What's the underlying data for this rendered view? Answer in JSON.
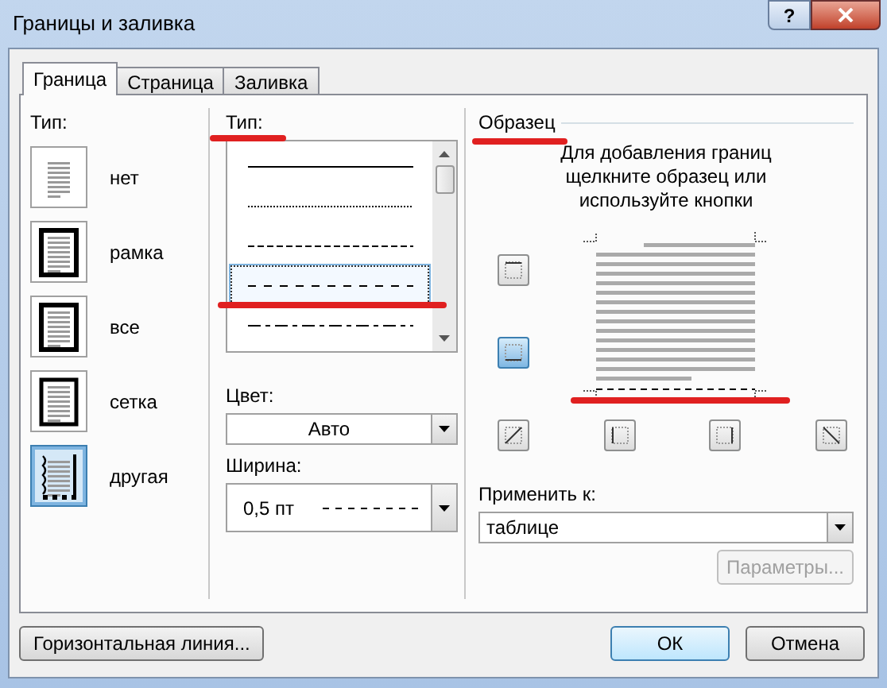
{
  "window": {
    "title": "Границы и заливка",
    "help": "?"
  },
  "tabs": [
    {
      "label": "Граница",
      "selected": true
    },
    {
      "label": "Страница",
      "selected": false
    },
    {
      "label": "Заливка",
      "selected": false
    }
  ],
  "setting": {
    "label": "Тип:",
    "items": [
      {
        "label": "нет",
        "kind": "none",
        "selected": false
      },
      {
        "label": "рамка",
        "kind": "box",
        "selected": false
      },
      {
        "label": "все",
        "kind": "all",
        "selected": false
      },
      {
        "label": "сетка",
        "kind": "grid",
        "selected": false
      },
      {
        "label": "другая",
        "kind": "custom",
        "selected": true
      }
    ]
  },
  "style": {
    "label": "Тип:",
    "items": [
      {
        "kind": "solid",
        "selected": false
      },
      {
        "kind": "dotted",
        "selected": false
      },
      {
        "kind": "dashed",
        "selected": false
      },
      {
        "kind": "long-dashed",
        "selected": true
      },
      {
        "kind": "dash-dot",
        "selected": false
      }
    ]
  },
  "color": {
    "label": "Цвет:",
    "value": "Авто"
  },
  "width": {
    "label": "Ширина:",
    "value": "0,5 пт"
  },
  "preview": {
    "title": "Образец",
    "hint": "Для добавления границ щелкните образец или используйте кнопки",
    "borders": [
      {
        "kind": "top",
        "on": false
      },
      {
        "kind": "bottom",
        "on": true
      },
      {
        "kind": "diag-up",
        "on": false
      },
      {
        "kind": "left",
        "on": false
      },
      {
        "kind": "right",
        "on": false
      },
      {
        "kind": "diag-down",
        "on": false
      }
    ]
  },
  "apply": {
    "label": "Применить к:",
    "value": "таблице",
    "options_button": "Параметры...",
    "options_disabled": true
  },
  "buttons": {
    "horizontal_line": "Горизонтальная линия...",
    "ok": "ОК",
    "cancel": "Отмена"
  }
}
